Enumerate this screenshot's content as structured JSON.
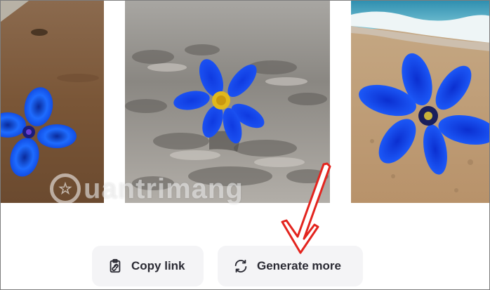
{
  "images": [
    {
      "name": "left-flower-image",
      "description": "blue flower on brown sand"
    },
    {
      "name": "center-flower-image",
      "description": "blue flower on gray sand"
    },
    {
      "name": "right-flower-image",
      "description": "blue flower on beach near waves"
    }
  ],
  "watermark": {
    "icon_glyph": "☆",
    "text": "uantrimang"
  },
  "actions": {
    "copy_link": {
      "label": "Copy link",
      "icon": "clipboard-link-icon"
    },
    "generate_more": {
      "label": "Generate more",
      "icon": "refresh-icon"
    }
  },
  "colors": {
    "button_bg": "#f4f4f6",
    "arrow": "#e3241e",
    "flower": "#1e5cf0"
  }
}
